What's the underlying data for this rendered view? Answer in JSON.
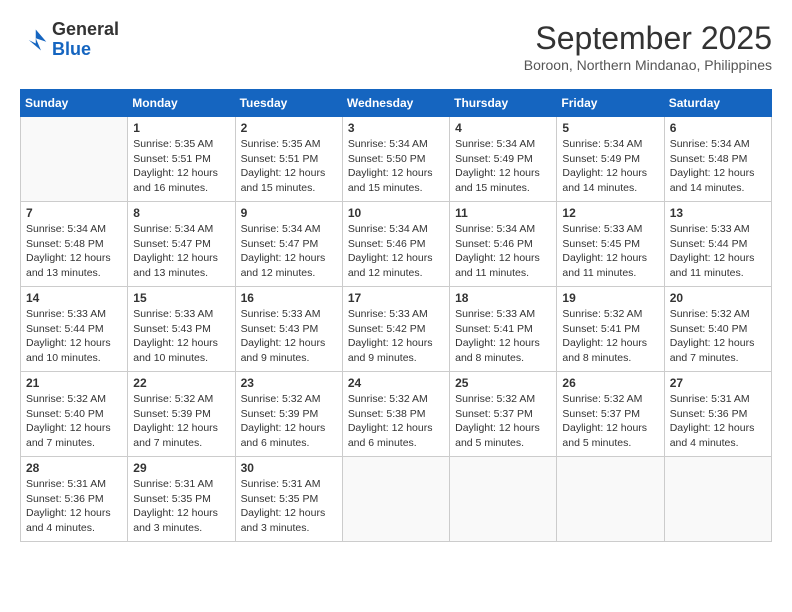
{
  "header": {
    "logo_general": "General",
    "logo_blue": "Blue",
    "month_title": "September 2025",
    "location": "Boroon, Northern Mindanao, Philippines"
  },
  "days_of_week": [
    "Sunday",
    "Monday",
    "Tuesday",
    "Wednesday",
    "Thursday",
    "Friday",
    "Saturday"
  ],
  "weeks": [
    [
      {
        "day": "",
        "info": ""
      },
      {
        "day": "1",
        "info": "Sunrise: 5:35 AM\nSunset: 5:51 PM\nDaylight: 12 hours\nand 16 minutes."
      },
      {
        "day": "2",
        "info": "Sunrise: 5:35 AM\nSunset: 5:51 PM\nDaylight: 12 hours\nand 15 minutes."
      },
      {
        "day": "3",
        "info": "Sunrise: 5:34 AM\nSunset: 5:50 PM\nDaylight: 12 hours\nand 15 minutes."
      },
      {
        "day": "4",
        "info": "Sunrise: 5:34 AM\nSunset: 5:49 PM\nDaylight: 12 hours\nand 15 minutes."
      },
      {
        "day": "5",
        "info": "Sunrise: 5:34 AM\nSunset: 5:49 PM\nDaylight: 12 hours\nand 14 minutes."
      },
      {
        "day": "6",
        "info": "Sunrise: 5:34 AM\nSunset: 5:48 PM\nDaylight: 12 hours\nand 14 minutes."
      }
    ],
    [
      {
        "day": "7",
        "info": "Sunrise: 5:34 AM\nSunset: 5:48 PM\nDaylight: 12 hours\nand 13 minutes."
      },
      {
        "day": "8",
        "info": "Sunrise: 5:34 AM\nSunset: 5:47 PM\nDaylight: 12 hours\nand 13 minutes."
      },
      {
        "day": "9",
        "info": "Sunrise: 5:34 AM\nSunset: 5:47 PM\nDaylight: 12 hours\nand 12 minutes."
      },
      {
        "day": "10",
        "info": "Sunrise: 5:34 AM\nSunset: 5:46 PM\nDaylight: 12 hours\nand 12 minutes."
      },
      {
        "day": "11",
        "info": "Sunrise: 5:34 AM\nSunset: 5:46 PM\nDaylight: 12 hours\nand 11 minutes."
      },
      {
        "day": "12",
        "info": "Sunrise: 5:33 AM\nSunset: 5:45 PM\nDaylight: 12 hours\nand 11 minutes."
      },
      {
        "day": "13",
        "info": "Sunrise: 5:33 AM\nSunset: 5:44 PM\nDaylight: 12 hours\nand 11 minutes."
      }
    ],
    [
      {
        "day": "14",
        "info": "Sunrise: 5:33 AM\nSunset: 5:44 PM\nDaylight: 12 hours\nand 10 minutes."
      },
      {
        "day": "15",
        "info": "Sunrise: 5:33 AM\nSunset: 5:43 PM\nDaylight: 12 hours\nand 10 minutes."
      },
      {
        "day": "16",
        "info": "Sunrise: 5:33 AM\nSunset: 5:43 PM\nDaylight: 12 hours\nand 9 minutes."
      },
      {
        "day": "17",
        "info": "Sunrise: 5:33 AM\nSunset: 5:42 PM\nDaylight: 12 hours\nand 9 minutes."
      },
      {
        "day": "18",
        "info": "Sunrise: 5:33 AM\nSunset: 5:41 PM\nDaylight: 12 hours\nand 8 minutes."
      },
      {
        "day": "19",
        "info": "Sunrise: 5:32 AM\nSunset: 5:41 PM\nDaylight: 12 hours\nand 8 minutes."
      },
      {
        "day": "20",
        "info": "Sunrise: 5:32 AM\nSunset: 5:40 PM\nDaylight: 12 hours\nand 7 minutes."
      }
    ],
    [
      {
        "day": "21",
        "info": "Sunrise: 5:32 AM\nSunset: 5:40 PM\nDaylight: 12 hours\nand 7 minutes."
      },
      {
        "day": "22",
        "info": "Sunrise: 5:32 AM\nSunset: 5:39 PM\nDaylight: 12 hours\nand 7 minutes."
      },
      {
        "day": "23",
        "info": "Sunrise: 5:32 AM\nSunset: 5:39 PM\nDaylight: 12 hours\nand 6 minutes."
      },
      {
        "day": "24",
        "info": "Sunrise: 5:32 AM\nSunset: 5:38 PM\nDaylight: 12 hours\nand 6 minutes."
      },
      {
        "day": "25",
        "info": "Sunrise: 5:32 AM\nSunset: 5:37 PM\nDaylight: 12 hours\nand 5 minutes."
      },
      {
        "day": "26",
        "info": "Sunrise: 5:32 AM\nSunset: 5:37 PM\nDaylight: 12 hours\nand 5 minutes."
      },
      {
        "day": "27",
        "info": "Sunrise: 5:31 AM\nSunset: 5:36 PM\nDaylight: 12 hours\nand 4 minutes."
      }
    ],
    [
      {
        "day": "28",
        "info": "Sunrise: 5:31 AM\nSunset: 5:36 PM\nDaylight: 12 hours\nand 4 minutes."
      },
      {
        "day": "29",
        "info": "Sunrise: 5:31 AM\nSunset: 5:35 PM\nDaylight: 12 hours\nand 3 minutes."
      },
      {
        "day": "30",
        "info": "Sunrise: 5:31 AM\nSunset: 5:35 PM\nDaylight: 12 hours\nand 3 minutes."
      },
      {
        "day": "",
        "info": ""
      },
      {
        "day": "",
        "info": ""
      },
      {
        "day": "",
        "info": ""
      },
      {
        "day": "",
        "info": ""
      }
    ]
  ]
}
